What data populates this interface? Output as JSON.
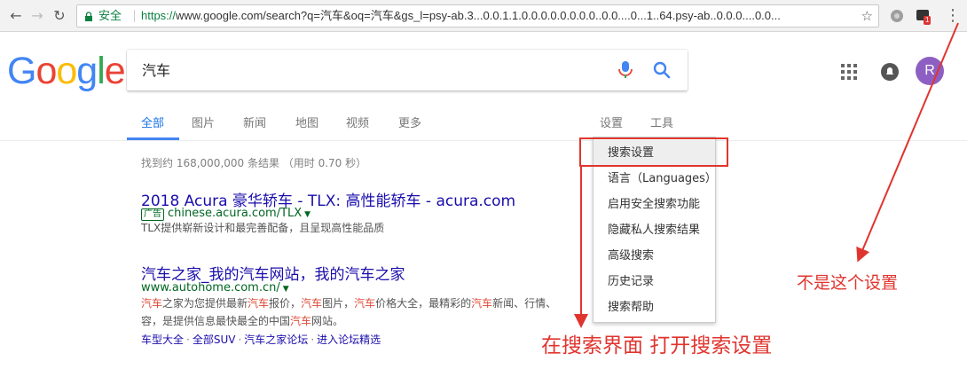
{
  "browser": {
    "secure_label": "安全",
    "url_scheme": "https://",
    "url_rest": "www.google.com/search?q=汽车&oq=汽车&gs_l=psy-ab.3...0.0.1.1.0.0.0.0.0.0.0.0..0.0....0...1..64.psy-ab..0.0.0....0.0...",
    "extension_badge": "1"
  },
  "logo": {
    "letters": [
      {
        "char": "G",
        "color": "#4285f4"
      },
      {
        "char": "o",
        "color": "#ea4335"
      },
      {
        "char": "o",
        "color": "#fbbc05"
      },
      {
        "char": "g",
        "color": "#4285f4"
      },
      {
        "char": "l",
        "color": "#34a853"
      },
      {
        "char": "e",
        "color": "#ea4335"
      }
    ]
  },
  "search": {
    "query": "汽车"
  },
  "account": {
    "avatar_letter": "R",
    "avatar_color": "#8e5fc2"
  },
  "tabs": {
    "all": "全部",
    "images": "图片",
    "news": "新闻",
    "maps": "地图",
    "videos": "视频",
    "more": "更多",
    "settings": "设置",
    "tools": "工具"
  },
  "result_stats": "找到约 168,000,000 条结果 （用时 0.70 秒）",
  "results": [
    {
      "title": "2018 Acura 豪华轿车 - TLX: 高性能轿车 - acura.com",
      "ad_label": "广告",
      "url": "chinese.acura.com/TLX",
      "snippet": "TLX提供崭新设计和最完善配备，且呈现高性能品质"
    },
    {
      "title": "汽车之家_我的汽车网站，我的汽车之家",
      "url": "www.autohome.com.cn/",
      "snippet_parts": [
        {
          "text": "汽车",
          "em": true
        },
        {
          "text": "之家为您提供最新",
          "em": false
        },
        {
          "text": "汽车",
          "em": true
        },
        {
          "text": "报价，",
          "em": false
        },
        {
          "text": "汽车",
          "em": true
        },
        {
          "text": "图片，",
          "em": false
        },
        {
          "text": "汽车",
          "em": true
        },
        {
          "text": "价格大全，最精彩的",
          "em": false
        },
        {
          "text": "汽车",
          "em": true
        },
        {
          "text": "新闻、行情、",
          "em": false
        }
      ],
      "snippet_line2_parts": [
        {
          "text": "容，是提供信息最快最全的中国",
          "em": false
        },
        {
          "text": "汽车",
          "em": true
        },
        {
          "text": "网站。",
          "em": false
        }
      ],
      "sitelinks": [
        "车型大全",
        "全部SUV",
        "汽车之家论坛",
        "进入论坛精选"
      ]
    }
  ],
  "settings_menu": [
    "搜索设置",
    "语言（Languages）",
    "启用安全搜索功能",
    "隐藏私人搜索结果",
    "高级搜索",
    "历史记录",
    "搜索帮助"
  ],
  "annotations": {
    "not_this_setting": "不是这个设置",
    "open_search_settings": "在搜索界面 打开搜索设置",
    "color": "#e0352f"
  }
}
